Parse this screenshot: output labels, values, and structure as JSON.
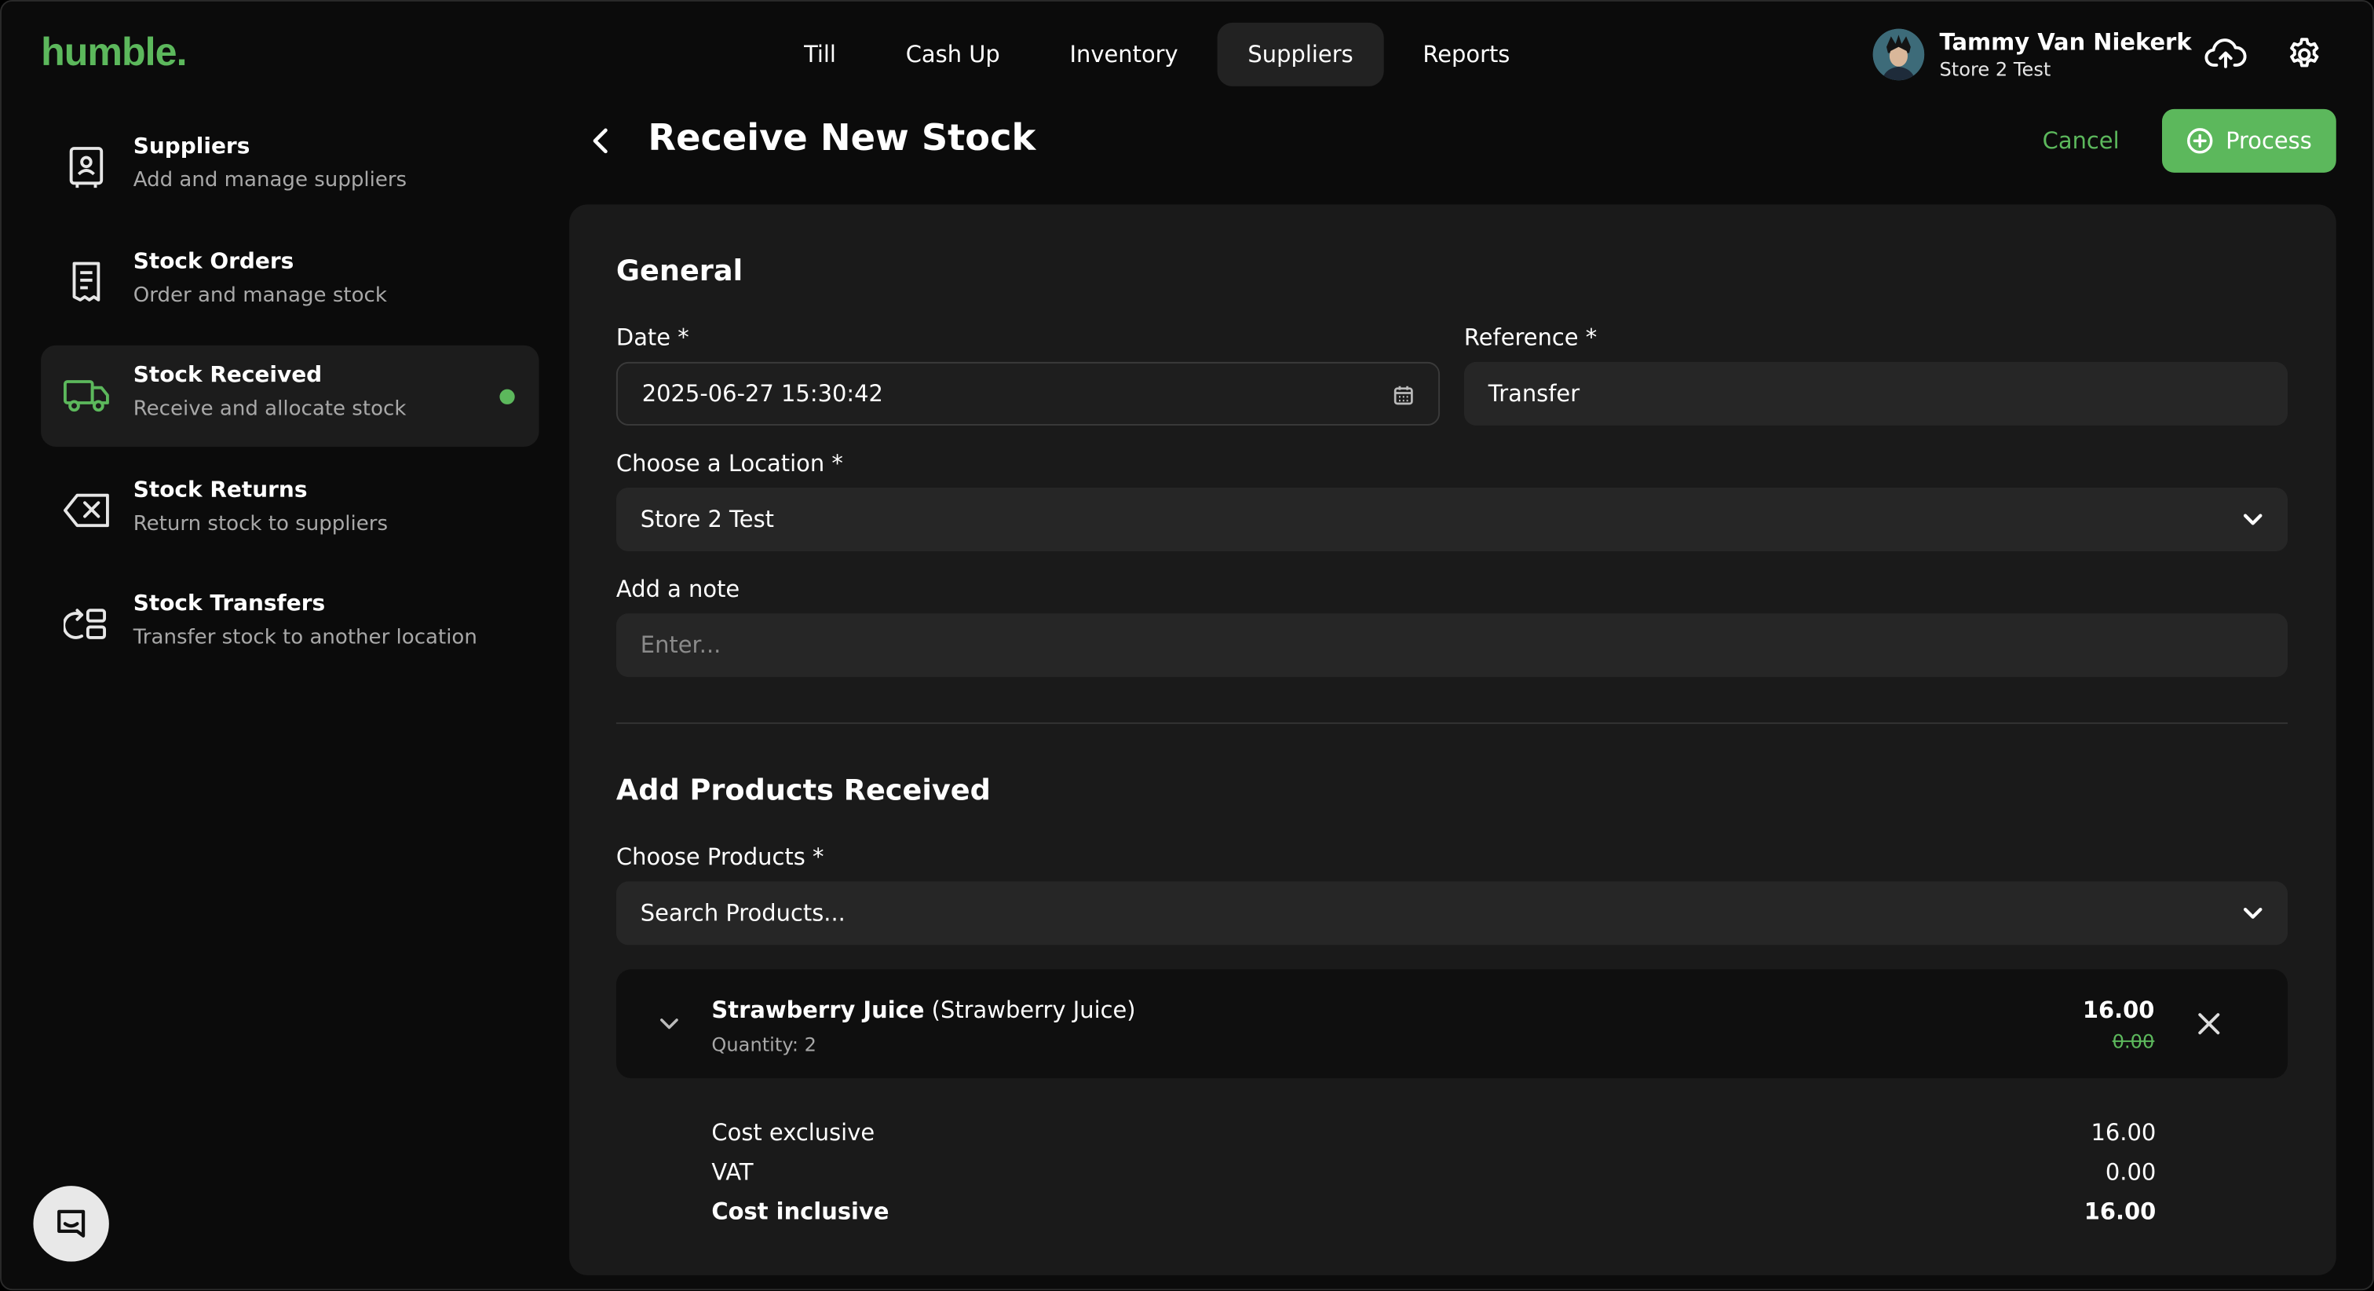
{
  "app": {
    "logo": "humble."
  },
  "topnav": [
    {
      "label": "Till",
      "active": false
    },
    {
      "label": "Cash Up",
      "active": false
    },
    {
      "label": "Inventory",
      "active": false
    },
    {
      "label": "Suppliers",
      "active": true
    },
    {
      "label": "Reports",
      "active": false
    }
  ],
  "user": {
    "name": "Tammy Van Niekerk",
    "store": "Store 2 Test"
  },
  "icons": {
    "upload": "cloud-upload-icon",
    "settings": "gear-icon",
    "chat": "chat-icon"
  },
  "sidebar": {
    "items": [
      {
        "title": "Suppliers",
        "subtitle": "Add and manage suppliers",
        "icon": "supplier-contact-icon",
        "active": false
      },
      {
        "title": "Stock Orders",
        "subtitle": "Order and manage stock",
        "icon": "receipt-icon",
        "active": false
      },
      {
        "title": "Stock Received",
        "subtitle": "Receive and allocate stock",
        "icon": "truck-icon",
        "active": true
      },
      {
        "title": "Stock Returns",
        "subtitle": "Return stock to suppliers",
        "icon": "backspace-icon",
        "active": false
      },
      {
        "title": "Stock Transfers",
        "subtitle": "Transfer stock to another location",
        "icon": "transfer-icon",
        "active": false
      }
    ]
  },
  "header": {
    "title": "Receive New Stock",
    "cancel_label": "Cancel",
    "process_label": "Process"
  },
  "general": {
    "title": "General",
    "date_label": "Date *",
    "date_value": "2025-06-27 15:30:42",
    "reference_label": "Reference *",
    "reference_value": "Transfer",
    "location_label": "Choose a Location *",
    "location_value": "Store 2 Test",
    "note_label": "Add a note",
    "note_placeholder": "Enter..."
  },
  "products": {
    "title": "Add Products Received",
    "choose_label": "Choose Products *",
    "search_placeholder": "Search Products...",
    "items": [
      {
        "name": "Strawberry Juice",
        "variant": "(Strawberry Juice)",
        "quantity": "Quantity: 2",
        "total": "16.00",
        "previous": "0.00",
        "costs": [
          {
            "label": "Cost exclusive",
            "value": "16.00",
            "bold": false
          },
          {
            "label": "VAT",
            "value": "0.00",
            "bold": false
          },
          {
            "label": "Cost inclusive",
            "value": "16.00",
            "bold": true
          }
        ]
      }
    ]
  },
  "colors": {
    "accent": "#5cb85c",
    "background": "#0b0b0b",
    "card": "#1a1a1a",
    "field": "#262626"
  }
}
